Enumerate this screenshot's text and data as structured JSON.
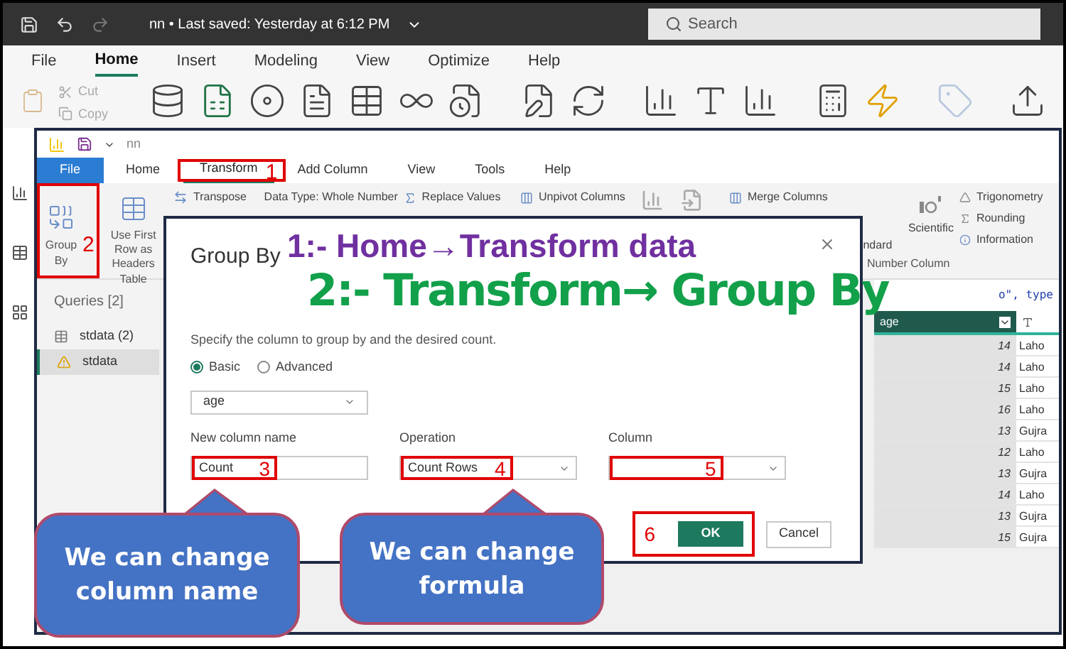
{
  "app": {
    "title": "nn • Last saved: Yesterday at 6:12 PM",
    "search_placeholder": "Search"
  },
  "menu_tabs": [
    {
      "label": "File",
      "selected": false
    },
    {
      "label": "Home",
      "selected": true
    },
    {
      "label": "Insert",
      "selected": false
    },
    {
      "label": "Modeling",
      "selected": false
    },
    {
      "label": "View",
      "selected": false
    },
    {
      "label": "Optimize",
      "selected": false
    },
    {
      "label": "Help",
      "selected": false
    }
  ],
  "clipboard": [
    "Cut",
    "Copy"
  ],
  "editor": {
    "title": "nn",
    "tabs": [
      {
        "label": "File",
        "kind": "file",
        "selected": false
      },
      {
        "label": "Home",
        "kind": "tab",
        "selected": false
      },
      {
        "label": "Transform",
        "kind": "tab",
        "selected": true,
        "step": "1"
      },
      {
        "label": "Add Column",
        "kind": "tab",
        "selected": false
      },
      {
        "label": "View",
        "kind": "tab",
        "selected": false
      },
      {
        "label": "Tools",
        "kind": "tab",
        "selected": false
      },
      {
        "label": "Help",
        "kind": "tab",
        "selected": false
      }
    ],
    "ribbon": {
      "group_by": {
        "label": "Group By",
        "step": "2"
      },
      "first_row": "Use First Row as Headers",
      "table_group": "Table",
      "transpose": "Transpose",
      "data_type": "Data Type: Whole Number",
      "replace": "Replace Values",
      "unpivot": "Unpivot Columns",
      "merge": "Merge Columns",
      "standard": "ndard",
      "scientific": "Scientific",
      "trig": "Trigonometry",
      "rounding": "Rounding",
      "information": "Information",
      "number_group": "Number Column"
    },
    "queries": {
      "title": "Queries [2]",
      "items": [
        {
          "name": "stdata (2)",
          "kind": "table",
          "selected": false
        },
        {
          "name": "stdata",
          "kind": "warning",
          "selected": true
        }
      ]
    },
    "formula": "o\", type",
    "table": {
      "column": "age",
      "rows": [
        {
          "age": "14",
          "city": "Laho"
        },
        {
          "age": "14",
          "city": "Laho"
        },
        {
          "age": "15",
          "city": "Laho"
        },
        {
          "age": "16",
          "city": "Laho"
        },
        {
          "age": "13",
          "city": "Gujra"
        },
        {
          "age": "12",
          "city": "Laho"
        },
        {
          "age": "13",
          "city": "Gujra"
        },
        {
          "age": "14",
          "city": "Laho"
        },
        {
          "age": "13",
          "city": "Gujra"
        },
        {
          "age": "15",
          "city": "Gujra"
        }
      ]
    }
  },
  "dialog": {
    "title": "Group By",
    "description": "Specify the column to group by and the desired count.",
    "modes": [
      {
        "label": "Basic",
        "selected": true
      },
      {
        "label": "Advanced",
        "selected": false
      }
    ],
    "group_column": "age",
    "fields": [
      {
        "label": "New column name",
        "kind": "text",
        "value": "Count",
        "step": "3"
      },
      {
        "label": "Operation",
        "kind": "dropdown",
        "value": "Count Rows",
        "step": "4"
      },
      {
        "label": "Column",
        "kind": "dropdown",
        "step": "5"
      }
    ],
    "buttons": [
      {
        "label": "OK",
        "kind": "primary",
        "step": "6"
      },
      {
        "label": "Cancel",
        "kind": "secondary"
      }
    ]
  },
  "annotations": [
    {
      "text": "1:- Home→Transform data",
      "kind": "small"
    },
    {
      "text": "2:- Transform→ Group By",
      "kind": "large"
    }
  ],
  "callouts": [
    "We can change column name",
    "We can change formula"
  ]
}
